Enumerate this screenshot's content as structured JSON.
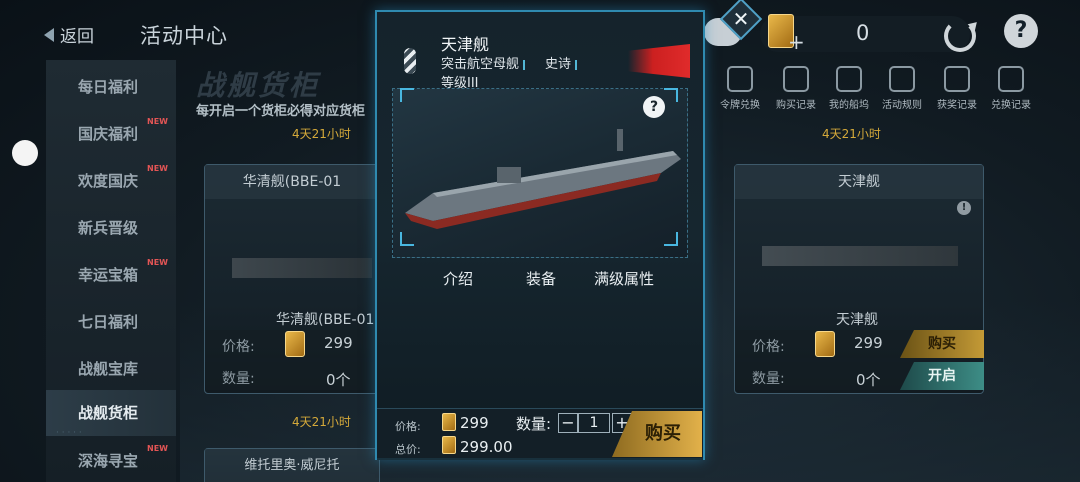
{
  "header": {
    "back_label": "返回",
    "title": "活动中心",
    "currency_value": "0"
  },
  "sidebar": {
    "items": [
      {
        "label": "每日福利",
        "new": false
      },
      {
        "label": "国庆福利",
        "new": true
      },
      {
        "label": "欢度国庆",
        "new": true
      },
      {
        "label": "新兵晋级",
        "new": false
      },
      {
        "label": "幸运宝箱",
        "new": true
      },
      {
        "label": "七日福利",
        "new": false
      },
      {
        "label": "战舰宝库",
        "new": false
      },
      {
        "label": "战舰货柜",
        "new": false,
        "active": true
      },
      {
        "label": "深海寻宝",
        "new": true
      }
    ],
    "new_tag": "NEW"
  },
  "section": {
    "title": "战舰货柜",
    "subtitle": "每开启一个货柜必得对应货柜"
  },
  "quick_actions": [
    {
      "label": "令牌兑换"
    },
    {
      "label": "购买记录"
    },
    {
      "label": "我的船坞"
    },
    {
      "label": "活动规则"
    },
    {
      "label": "获奖记录"
    },
    {
      "label": "兑换记录"
    }
  ],
  "cards": {
    "left_top": {
      "timer": "4天21小时",
      "header": "华清舰(BBE-01",
      "ship_name": "华清舰(BBE-01",
      "price_label": "价格:",
      "price": "299",
      "qty_label": "数量:",
      "qty": "0个"
    },
    "right_top": {
      "timer": "4天21小时",
      "header": "天津舰",
      "ship_name": "天津舰",
      "price_label": "价格:",
      "price": "299",
      "qty_label": "数量:",
      "qty": "0个",
      "buy_label": "购买",
      "open_label": "开启"
    },
    "left_bottom": {
      "timer": "4天21小时",
      "header": "维托里奥·威尼托"
    }
  },
  "modal": {
    "ship_name": "天津舰",
    "ship_type": "突击航空母舰",
    "ship_rarity": "史诗",
    "ship_level": "等级III",
    "tabs": [
      "介绍",
      "装备",
      "满级属性"
    ],
    "price_label": "价格:",
    "price": "299",
    "total_label": "总价:",
    "total": "299.00",
    "qty_label": "数量:",
    "qty_value": "1",
    "minus": "−",
    "plus": "+",
    "buy_label": "购买",
    "close_symbol": "✕",
    "help_symbol": "?"
  },
  "colors": {
    "accent": "#2f8ab0",
    "gold": "#d4a93a",
    "new_red": "#e35555"
  }
}
